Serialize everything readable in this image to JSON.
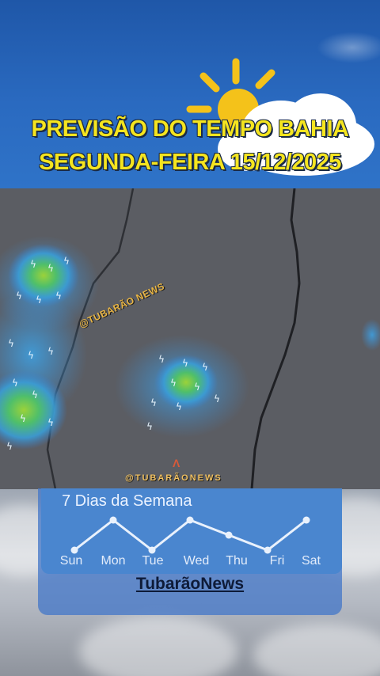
{
  "header": {
    "title_line1": "PREVISÃO DO TEMPO BAHIA",
    "title_line2": "SEGUNDA-FEIRA 15/12/2025"
  },
  "icons": {
    "weather": "sun-behind-cloud-icon",
    "lightning": "lightning-icon"
  },
  "watermarks": {
    "map_handle": "@TUBARÃO NEWS",
    "bottom_handle": "@TUBARÃONEWS"
  },
  "week_card": {
    "title": "7 Dias da Semana",
    "days": [
      "Sun",
      "Mon",
      "Tue",
      "Wed",
      "Thu",
      "Fri",
      "Sat"
    ]
  },
  "brand": "TubarãoNews",
  "colors": {
    "title_yellow": "#f5e51f",
    "header_blue": "#2a6ac0",
    "map_gray": "#5b5d63",
    "card_blue": "#4a86cf"
  }
}
